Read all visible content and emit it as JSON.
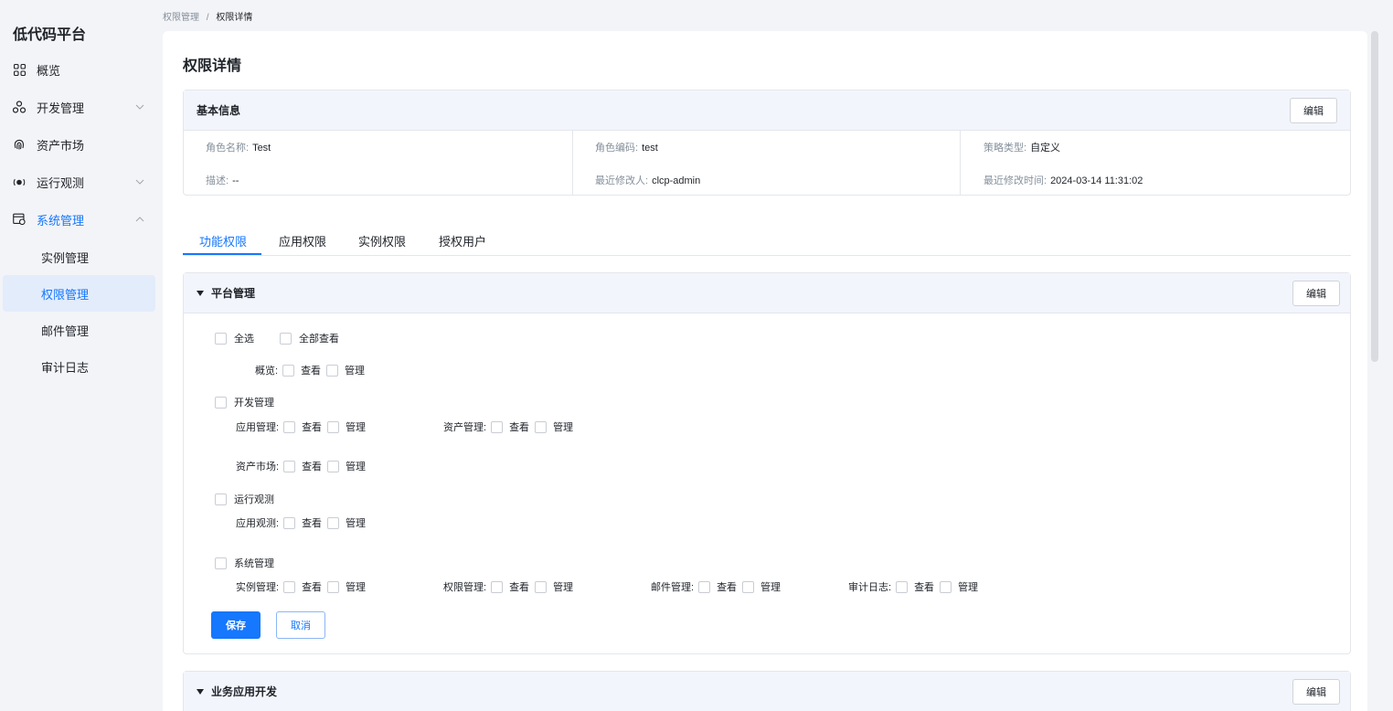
{
  "app": {
    "title": "低代码平台"
  },
  "sidebar": {
    "items": [
      {
        "label": "概览",
        "icon": "grid-icon"
      },
      {
        "label": "开发管理",
        "icon": "nodes-icon"
      },
      {
        "label": "资产市场",
        "icon": "fingerprint-icon"
      },
      {
        "label": "运行观测",
        "icon": "radar-icon"
      },
      {
        "label": "系统管理",
        "icon": "window-gear-icon"
      }
    ],
    "sub_items": [
      {
        "label": "实例管理"
      },
      {
        "label": "权限管理"
      },
      {
        "label": "邮件管理"
      },
      {
        "label": "审计日志"
      }
    ]
  },
  "breadcrumb": {
    "parent": "权限管理",
    "separator": "/",
    "current": "权限详情"
  },
  "page": {
    "title": "权限详情"
  },
  "basic_info": {
    "title": "基本信息",
    "edit_label": "编辑",
    "fields": {
      "role_name": {
        "label": "角色名称:",
        "value": "Test"
      },
      "role_code": {
        "label": "角色编码:",
        "value": "test"
      },
      "policy_type": {
        "label": "策略类型:",
        "value": "自定义"
      },
      "description": {
        "label": "描述:",
        "value": "--"
      },
      "modified_by": {
        "label": "最近修改人:",
        "value": "clcp-admin"
      },
      "modified_time": {
        "label": "最近修改时间:",
        "value": "2024-03-14 11:31:02"
      }
    }
  },
  "tabs": [
    {
      "label": "功能权限"
    },
    {
      "label": "应用权限"
    },
    {
      "label": "实例权限"
    },
    {
      "label": "授权用户"
    }
  ],
  "platform_panel": {
    "title": "平台管理",
    "edit_label": "编辑",
    "select_all": "全选",
    "view_all": "全部查看",
    "view": "查看",
    "manage": "管理",
    "overview": "概览:",
    "dev_group": "开发管理",
    "app_mgmt": "应用管理:",
    "asset_mgmt": "资产管理:",
    "asset_market": "资产市场:",
    "ops_group": "运行观测",
    "app_observe": "应用观测:",
    "sys_group": "系统管理",
    "instance_mgmt": "实例管理:",
    "perm_mgmt": "权限管理:",
    "mail_mgmt": "邮件管理:",
    "audit_log": "审计日志:",
    "save_label": "保存",
    "cancel_label": "取消"
  },
  "business_panel": {
    "title": "业务应用开发",
    "edit_label": "编辑"
  },
  "colors": {
    "accent": "#1677ff",
    "panel_head": "#f2f6fc",
    "selected_bg": "#e2ecfb"
  }
}
